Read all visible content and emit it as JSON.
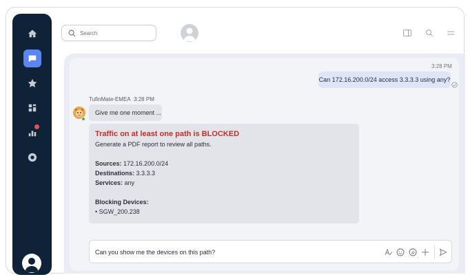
{
  "search": {
    "placeholder": "Search"
  },
  "chat": {
    "user_message": {
      "time": "3:28 PM",
      "text": "Can 172.16.200.0/24 access 3.3.3.3 using any?"
    },
    "bot": {
      "name": "TufinMate-EMEA",
      "time": "3:28 PM"
    },
    "bot_message_1": "Give me one moment ...",
    "bot_message_2": {
      "title": "Traffic on at least one path is BLOCKED",
      "subtitle": "Generate a PDF report to review all paths.",
      "sources_label": "Sources:",
      "sources_value": "172.16.200.0/24",
      "destinations_label": "Destinations:",
      "destinations_value": "3.3.3.3",
      "services_label": "Services:",
      "services_value": "any",
      "blocking_label": "Blocking Devices:",
      "blocking_item": "• SGW_200.238"
    }
  },
  "composer": {
    "value": "Can you show me the devices on this path?"
  },
  "colors": {
    "sidebar": "#0f2237",
    "accent": "#5b86f0",
    "blocked": "#c0302b",
    "user_bubble": "#dfe5f7",
    "bot_bubble": "#e2e4ea",
    "badge": "#e2554f"
  },
  "icons": {
    "sidebar": [
      "home-icon",
      "chat-icon",
      "star-icon",
      "dashboard-icon",
      "chart-icon",
      "settings-icon",
      "user-avatar-icon"
    ],
    "top": [
      "search-icon",
      "profile-avatar-icon",
      "panel-toggle-icon",
      "top-search-icon",
      "menu-icon"
    ],
    "composer": [
      "text-format-icon",
      "emoji-icon",
      "attach-icon",
      "plus-icon",
      "send-icon"
    ]
  }
}
